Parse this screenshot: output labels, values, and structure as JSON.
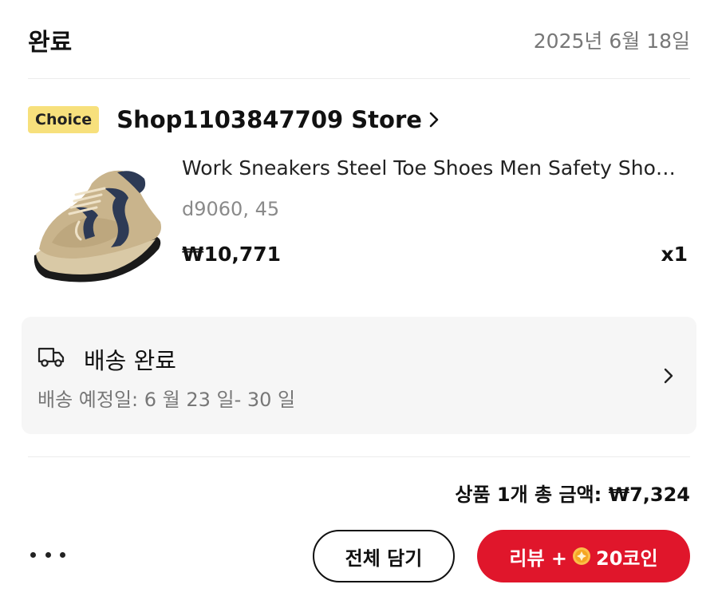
{
  "order": {
    "status": "완료",
    "date": "2025년 6월 18일"
  },
  "store": {
    "badge": "Choice",
    "name": "Shop1103847709 Store"
  },
  "product": {
    "title": "Work Sneakers Steel Toe Shoes Men Safety Sho…",
    "variant": "d9060, 45",
    "price": "₩10,771",
    "quantity": "x1"
  },
  "delivery": {
    "status": "배송 완료",
    "estimate": "배송 예정일: 6 월 23 일- 30 일"
  },
  "summary": {
    "total": "상품 1개 총 금액: ₩7,324"
  },
  "actions": {
    "add_all_label": "전체 담기",
    "review_label_prefix": "리뷰 +",
    "review_label_suffix": "20코인"
  },
  "colors": {
    "accent": "#e0162b",
    "badge": "#f7e07c",
    "coin": "#f5a623"
  },
  "icons": {
    "store_chevron": "chevron-right-icon",
    "delivery": "truck-icon",
    "card_chevron": "chevron-right-icon",
    "more": "more-dots-icon",
    "coin": "coin-icon"
  }
}
